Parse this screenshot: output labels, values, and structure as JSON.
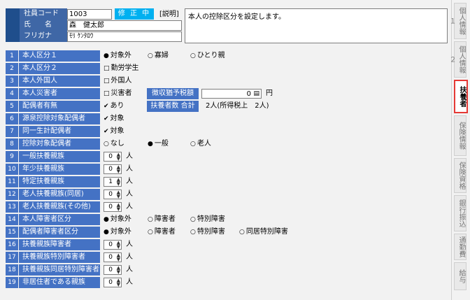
{
  "header": {
    "employee_code_label": "社員コード",
    "employee_code_value": "1003",
    "status_badge": "修 正 中",
    "description_label": "[説明]",
    "description_text": "本人の控除区分を設定します。",
    "name_label": "氏　　名",
    "name_value": "森　健太郎",
    "kana_label": "フリガナ",
    "kana_value": "ﾓﾘ ｹﾝﾀﾛｳ"
  },
  "rows": [
    {
      "num": "1",
      "label": "本人区分１"
    },
    {
      "num": "2",
      "label": "本人区分２"
    },
    {
      "num": "3",
      "label": "本人外国人"
    },
    {
      "num": "4",
      "label": "本人災害者"
    },
    {
      "num": "5",
      "label": "配偶者有無"
    },
    {
      "num": "6",
      "label": "源泉控除対象配偶者"
    },
    {
      "num": "7",
      "label": "同一生計配偶者"
    },
    {
      "num": "8",
      "label": "控除対象配偶者"
    },
    {
      "num": "9",
      "label": "一般扶養親族"
    },
    {
      "num": "10",
      "label": "年少扶養親族"
    },
    {
      "num": "11",
      "label": "特定扶養親族"
    },
    {
      "num": "12",
      "label": "老人扶養親族(同居)"
    },
    {
      "num": "13",
      "label": "老人扶養親族(その他)"
    },
    {
      "num": "14",
      "label": "本人障害者区分"
    },
    {
      "num": "15",
      "label": "配偶者障害者区分"
    },
    {
      "num": "16",
      "label": "扶養親族障害者"
    },
    {
      "num": "17",
      "label": "扶養親族特別障害者"
    },
    {
      "num": "18",
      "label": "扶養親族同居特別障害者"
    },
    {
      "num": "19",
      "label": "非居住者である親族"
    }
  ],
  "row1": {
    "opt1": "対象外",
    "opt2": "寡婦",
    "opt3": "ひとり親",
    "selected": "対象外"
  },
  "row2": {
    "opt1": "勤労学生"
  },
  "row3": {
    "opt1": "外国人"
  },
  "row4": {
    "opt1": "災害者",
    "tax_label": "徴収猶予税額",
    "tax_value": "0",
    "unit": "円"
  },
  "row5": {
    "opt1": "あり",
    "dependents_label": "扶養者数 合計",
    "dependents_value": "2人(所得税上　2人)"
  },
  "row6": {
    "opt1": "対象"
  },
  "row7": {
    "opt1": "対象"
  },
  "row8": {
    "opt1": "なし",
    "opt2": "一般",
    "opt3": "老人",
    "selected": "一般"
  },
  "counts": {
    "r9": "0",
    "r10": "0",
    "r11": "1",
    "r12": "0",
    "r13": "0",
    "r16": "0",
    "r17": "0",
    "r18": "0",
    "r19": "0",
    "unit": "人"
  },
  "row14": {
    "opt1": "対象外",
    "opt2": "障害者",
    "opt3": "特別障害",
    "selected": "対象外"
  },
  "row15": {
    "opt1": "対象外",
    "opt2": "障害者",
    "opt3": "特別障害",
    "opt4": "同居特別障害",
    "selected": "対象外"
  },
  "sidetabs": [
    {
      "label": "個人情報１",
      "active": false
    },
    {
      "label": "個人情報２",
      "active": false
    },
    {
      "label": "扶養者",
      "active": true
    },
    {
      "label": "保険情報",
      "active": false
    },
    {
      "label": "保険資格",
      "active": false
    },
    {
      "label": "銀行振込",
      "active": false
    },
    {
      "label": "通勤費",
      "active": false
    },
    {
      "label": "給与",
      "active": false
    }
  ],
  "icons": {
    "radio_on": "●",
    "radio_off": "○",
    "check_on": "✔",
    "check_off": "□",
    "spin_up": "▲",
    "spin_down": "▼",
    "calc": "▤"
  }
}
